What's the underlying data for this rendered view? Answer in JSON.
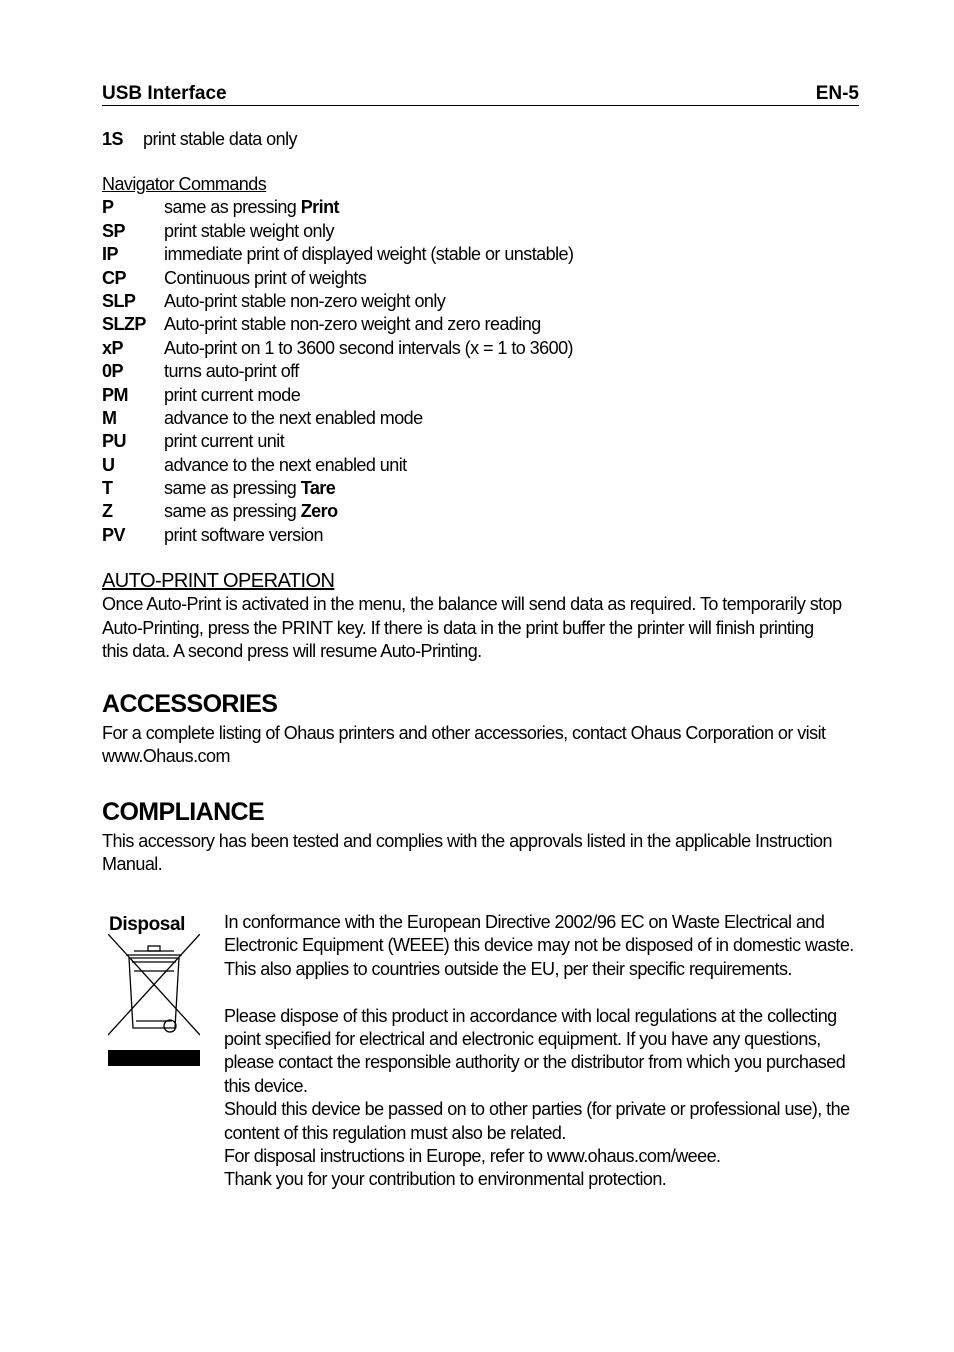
{
  "header": {
    "section": "USB Interface",
    "page": "EN-5"
  },
  "print_stable": {
    "key": "1S",
    "desc": "print stable data only"
  },
  "navigator": {
    "title": "Navigator Commands",
    "commands": [
      {
        "key": "P",
        "desc": "same as pressing ",
        "bold": "Print"
      },
      {
        "key": "SP",
        "desc": "print stable weight only"
      },
      {
        "key": "IP",
        "desc": "immediate print of displayed weight (stable or unstable)"
      },
      {
        "key": "CP",
        "desc": "Continuous print of weights"
      },
      {
        "key": "SLP",
        "desc": "Auto-print stable non-zero weight only"
      },
      {
        "key": "SLZP",
        "desc": "Auto-print stable non-zero weight and zero reading"
      },
      {
        "key": "xP",
        "desc": "Auto-print on 1 to 3600 second intervals (x = 1 to 3600)"
      },
      {
        "key": "0P",
        "desc": "turns auto-print off"
      },
      {
        "key": "PM",
        "desc": "print current mode"
      },
      {
        "key": "M",
        "desc": "advance to the next enabled mode"
      },
      {
        "key": "PU",
        "desc": "print current unit"
      },
      {
        "key": "U",
        "desc": "advance to the next enabled unit"
      },
      {
        "key": "T",
        "desc": "same as pressing ",
        "bold": "Tare"
      },
      {
        "key": "Z",
        "desc": "same as pressing ",
        "bold": "Zero"
      },
      {
        "key": "PV",
        "desc": "print software version"
      }
    ]
  },
  "auto_print": {
    "title": "AUTO-PRINT OPERATION",
    "lines": [
      "Once Auto-Print is activated in the menu, the balance will send data as required.  To temporarily stop",
      "Auto-Printing, press the PRINT key.  If there is data in the print buffer the printer will finish printing",
      "this data. A second press will resume Auto-Printing."
    ]
  },
  "accessories": {
    "title": "ACCESSORIES",
    "lines": [
      "For a complete listing of Ohaus printers and other accessories, contact Ohaus Corporation or visit",
      "www.Ohaus.com"
    ]
  },
  "compliance": {
    "title": "COMPLIANCE",
    "lines": [
      "This accessory has been tested and complies with the approvals listed in the applicable Instruction",
      "Manual."
    ]
  },
  "disposal": {
    "title": "Disposal",
    "icon": "weee-crossed-bin-icon",
    "para1": [
      "In conformance with the European Directive 2002/96 EC on Waste Electrical and",
      "Electronic Equipment (WEEE) this device may not be disposed of in domestic waste.",
      "This also applies to countries outside the EU, per their specific requirements."
    ],
    "para2": [
      "Please dispose of this product in accordance with local regulations at the collecting",
      "point specified for electrical and electronic equipment. If you have any questions,",
      "please contact the responsible authority or the distributor from which you purchased",
      "this device.",
      "Should this device be passed on to other parties (for private or professional use), the",
      "content of this regulation must also be related.",
      "For disposal instructions in Europe, refer to www.ohaus.com/weee.",
      "Thank you for your contribution to environmental protection."
    ]
  }
}
